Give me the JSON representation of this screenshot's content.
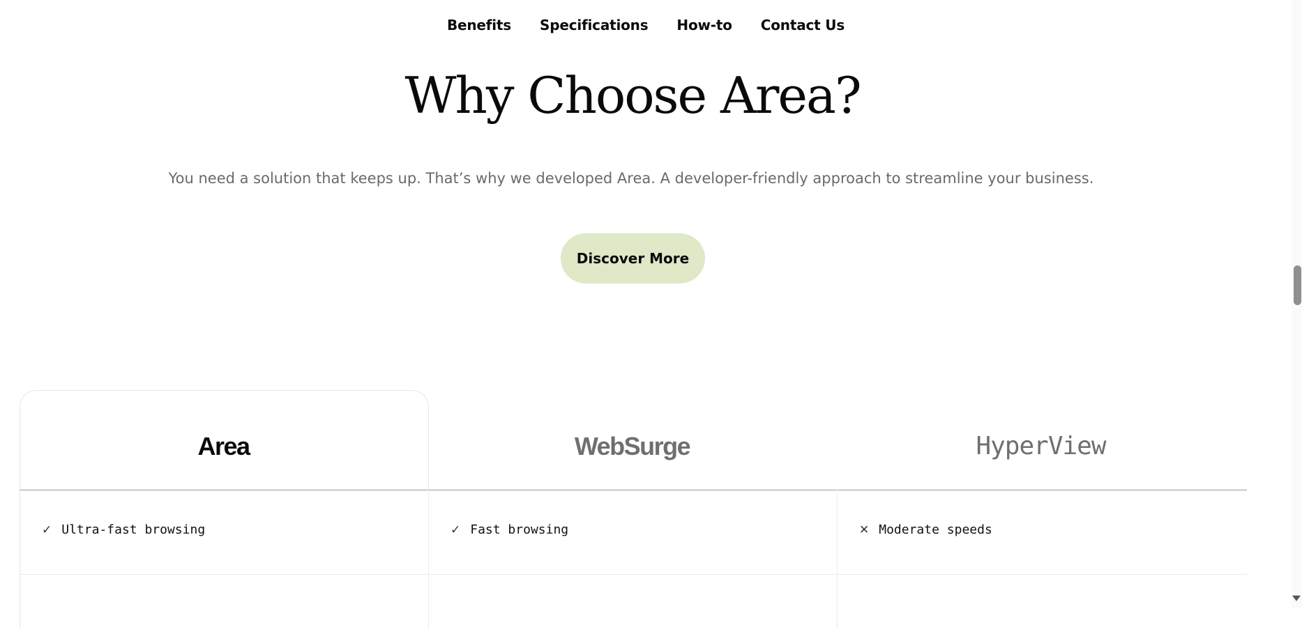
{
  "nav": {
    "items": [
      {
        "label": "Benefits"
      },
      {
        "label": "Specifications"
      },
      {
        "label": "How-to"
      },
      {
        "label": "Contact Us"
      }
    ]
  },
  "hero": {
    "title": "Why Choose Area?",
    "subtitle": "You need a solution that keeps up. That’s why we developed Area. A developer-friendly approach to streamline your business.",
    "cta_label": "Discover More",
    "cta_color": "#dfe8c7"
  },
  "comparison": {
    "brands": [
      "Area",
      "WebSurge",
      "HyperView"
    ],
    "rows": [
      {
        "cells": [
          {
            "icon": "check-icon",
            "symbol": "✓",
            "text": "Ultra-fast browsing"
          },
          {
            "icon": "check-icon",
            "symbol": "✓",
            "text": "Fast browsing"
          },
          {
            "icon": "cross-icon",
            "symbol": "✕",
            "text": "Moderate speeds"
          }
        ]
      }
    ]
  }
}
